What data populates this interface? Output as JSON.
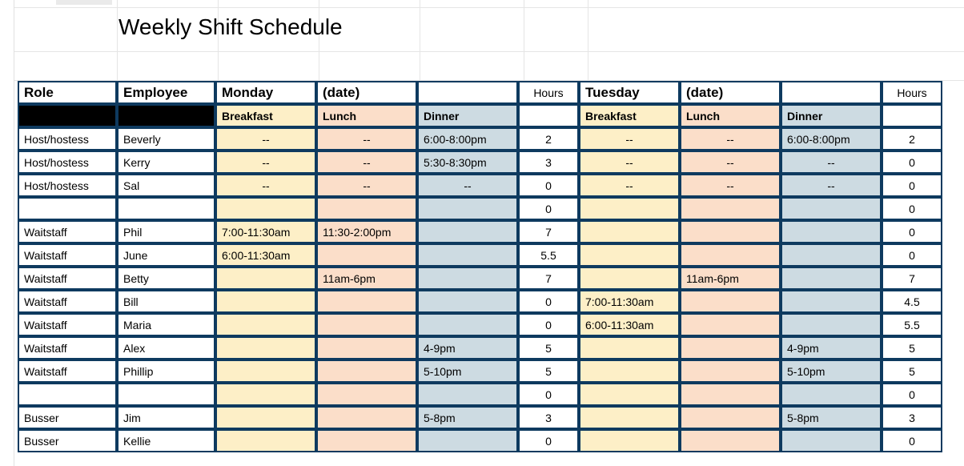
{
  "title": "Weekly Shift Schedule",
  "headers": {
    "role": "Role",
    "employee": "Employee",
    "days": [
      {
        "day": "Monday",
        "date": "(date)"
      },
      {
        "day": "Tuesday",
        "date": "(date)"
      }
    ],
    "hours": "Hours",
    "meals": {
      "breakfast": "Breakfast",
      "lunch": "Lunch",
      "dinner": "Dinner"
    }
  },
  "rows": [
    {
      "role": "Host/hostess",
      "emp": "Beverly",
      "mon": {
        "b": "--",
        "l": "--",
        "d": "6:00-8:00pm",
        "h": "2"
      },
      "tue": {
        "b": "--",
        "l": "--",
        "d": "6:00-8:00pm",
        "h": "2"
      }
    },
    {
      "role": "Host/hostess",
      "emp": "Kerry",
      "mon": {
        "b": "--",
        "l": "--",
        "d": "5:30-8:30pm",
        "h": "3"
      },
      "tue": {
        "b": "--",
        "l": "--",
        "d": "--",
        "h": "0"
      }
    },
    {
      "role": "Host/hostess",
      "emp": "Sal",
      "mon": {
        "b": "--",
        "l": "--",
        "d": "--",
        "h": "0"
      },
      "tue": {
        "b": "--",
        "l": "--",
        "d": "--",
        "h": "0"
      }
    },
    {
      "role": "",
      "emp": "",
      "mon": {
        "b": "",
        "l": "",
        "d": "",
        "h": "0"
      },
      "tue": {
        "b": "",
        "l": "",
        "d": "",
        "h": "0"
      }
    },
    {
      "role": "Waitstaff",
      "emp": "Phil",
      "mon": {
        "b": "7:00-11:30am",
        "l": "11:30-2:00pm",
        "d": "",
        "h": "7"
      },
      "tue": {
        "b": "",
        "l": "",
        "d": "",
        "h": "0"
      }
    },
    {
      "role": "Waitstaff",
      "emp": "June",
      "mon": {
        "b": "6:00-11:30am",
        "l": "",
        "d": "",
        "h": "5.5"
      },
      "tue": {
        "b": "",
        "l": "",
        "d": "",
        "h": "0"
      }
    },
    {
      "role": "Waitstaff",
      "emp": "Betty",
      "mon": {
        "b": "",
        "l": "11am-6pm",
        "d": "",
        "h": "7"
      },
      "tue": {
        "b": "",
        "l": "11am-6pm",
        "d": "",
        "h": "7"
      }
    },
    {
      "role": "Waitstaff",
      "emp": "Bill",
      "mon": {
        "b": "",
        "l": "",
        "d": "",
        "h": "0"
      },
      "tue": {
        "b": "7:00-11:30am",
        "l": "",
        "d": "",
        "h": "4.5"
      }
    },
    {
      "role": "Waitstaff",
      "emp": "Maria",
      "mon": {
        "b": "",
        "l": "",
        "d": "",
        "h": "0"
      },
      "tue": {
        "b": "6:00-11:30am",
        "l": "",
        "d": "",
        "h": "5.5"
      }
    },
    {
      "role": "Waitstaff",
      "emp": "Alex",
      "mon": {
        "b": "",
        "l": "",
        "d": "4-9pm",
        "h": "5"
      },
      "tue": {
        "b": "",
        "l": "",
        "d": "4-9pm",
        "h": "5"
      }
    },
    {
      "role": "Waitstaff",
      "emp": "Phillip",
      "mon": {
        "b": "",
        "l": "",
        "d": "5-10pm",
        "h": "5"
      },
      "tue": {
        "b": "",
        "l": "",
        "d": "5-10pm",
        "h": "5"
      }
    },
    {
      "role": "",
      "emp": "",
      "mon": {
        "b": "",
        "l": "",
        "d": "",
        "h": "0"
      },
      "tue": {
        "b": "",
        "l": "",
        "d": "",
        "h": "0"
      }
    },
    {
      "role": "Busser",
      "emp": "Jim",
      "mon": {
        "b": "",
        "l": "",
        "d": "5-8pm",
        "h": "3"
      },
      "tue": {
        "b": "",
        "l": "",
        "d": "5-8pm",
        "h": "3"
      }
    },
    {
      "role": "Busser",
      "emp": "Kellie",
      "mon": {
        "b": "",
        "l": "",
        "d": "",
        "h": "0"
      },
      "tue": {
        "b": "",
        "l": "",
        "d": "",
        "h": "0"
      }
    }
  ]
}
